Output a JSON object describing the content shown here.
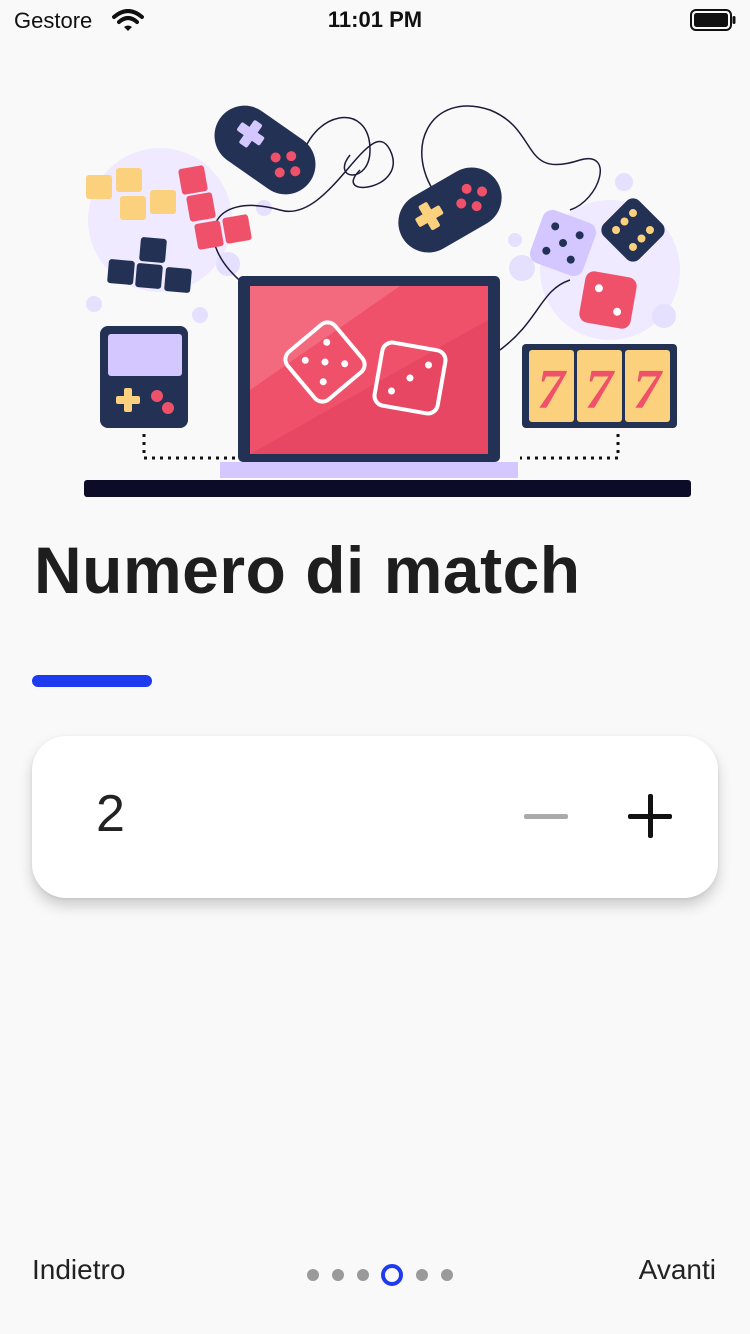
{
  "status_bar": {
    "carrier": "Gestore",
    "time": "11:01 PM",
    "wifi_icon": "wifi-icon",
    "battery_icon": "battery-icon"
  },
  "illustration": {
    "name": "gaming-illustration",
    "slot_text": "777"
  },
  "page": {
    "title": "Numero di match",
    "accent_color": "#1f3bf0"
  },
  "stepper": {
    "value": "2",
    "minus_icon": "minus-icon",
    "plus_icon": "plus-icon",
    "minus_enabled": false
  },
  "navigation": {
    "back_label": "Indietro",
    "next_label": "Avanti",
    "page_count": 6,
    "current_page": 4
  }
}
